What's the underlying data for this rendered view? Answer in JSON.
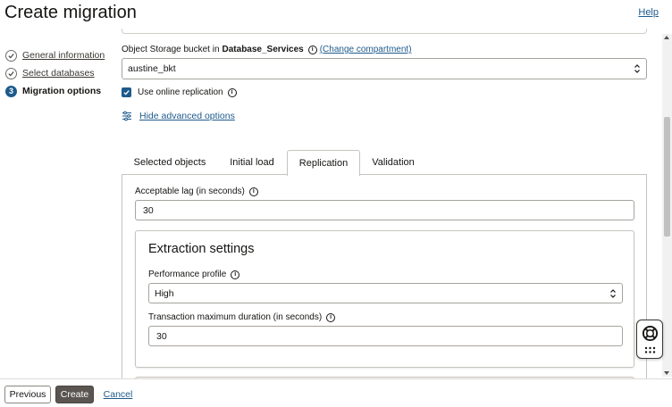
{
  "header": {
    "title": "Create migration",
    "help_label": "Help"
  },
  "steps": [
    {
      "number": "",
      "label": "General information",
      "state": "done"
    },
    {
      "number": "",
      "label": "Select databases",
      "state": "done"
    },
    {
      "number": "3",
      "label": "Migration options",
      "state": "current"
    }
  ],
  "bucket": {
    "label_prefix": "Object Storage bucket in",
    "compartment": "Database_Services",
    "change_link": "(Change compartment)",
    "value": "austine_bkt"
  },
  "online_replication": {
    "label": "Use online replication",
    "checked": true
  },
  "advanced": {
    "link": "Hide advanced options"
  },
  "tabs": [
    {
      "label": "Selected objects",
      "active": false
    },
    {
      "label": "Initial load",
      "active": false
    },
    {
      "label": "Replication",
      "active": true
    },
    {
      "label": "Validation",
      "active": false
    }
  ],
  "replication": {
    "lag_label": "Acceptable lag (in seconds)",
    "lag_value": "30",
    "extraction": {
      "title": "Extraction settings",
      "perf_label": "Performance profile",
      "perf_value": "High",
      "duration_label": "Transaction maximum duration (in seconds)",
      "duration_value": "30"
    }
  },
  "info_glyph": "i",
  "icons": {
    "check": "check-icon",
    "info": "info-icon",
    "sliders": "sliders-icon",
    "lifebuoy": "lifebuoy-icon",
    "dots": "dots-grid-icon",
    "select_arrows": "chevron-up-down-icon"
  },
  "footer": {
    "previous": "Previous",
    "create": "Create",
    "cancel": "Cancel"
  },
  "colors": {
    "link": "#1d5a8c",
    "primary_button": "#5a5551",
    "checkbox": "#1d5a8c"
  }
}
